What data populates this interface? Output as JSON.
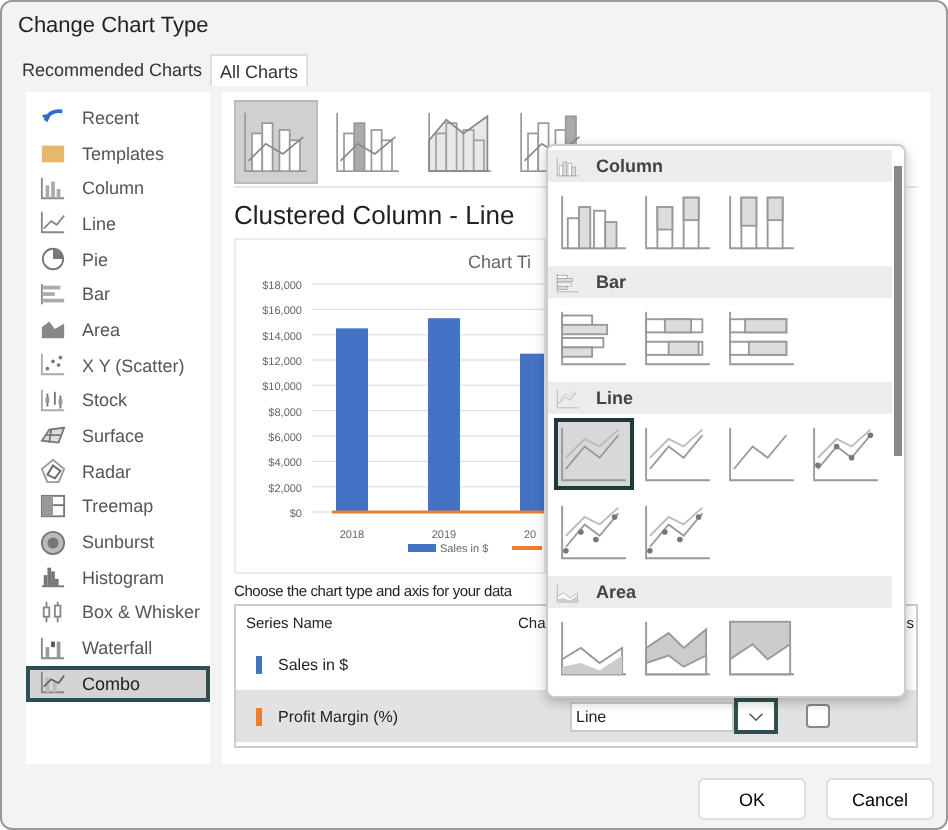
{
  "window": {
    "title": "Change Chart Type"
  },
  "tabs": [
    {
      "label": "Recommended Charts",
      "selected": false
    },
    {
      "label": "All Charts",
      "selected": true
    }
  ],
  "sidebar": {
    "items": [
      {
        "label": "Recent",
        "selected": false
      },
      {
        "label": "Templates",
        "selected": false
      },
      {
        "label": "Column",
        "selected": false
      },
      {
        "label": "Line",
        "selected": false
      },
      {
        "label": "Pie",
        "selected": false
      },
      {
        "label": "Bar",
        "selected": false
      },
      {
        "label": "Area",
        "selected": false
      },
      {
        "label": "X Y (Scatter)",
        "selected": false
      },
      {
        "label": "Stock",
        "selected": false
      },
      {
        "label": "Surface",
        "selected": false
      },
      {
        "label": "Radar",
        "selected": false
      },
      {
        "label": "Treemap",
        "selected": false
      },
      {
        "label": "Sunburst",
        "selected": false
      },
      {
        "label": "Histogram",
        "selected": false
      },
      {
        "label": "Box & Whisker",
        "selected": false
      },
      {
        "label": "Waterfall",
        "selected": false
      },
      {
        "label": "Combo",
        "selected": true
      }
    ]
  },
  "subtypes": [
    {
      "selected": true
    },
    {
      "selected": false
    },
    {
      "selected": false
    },
    {
      "selected": false
    }
  ],
  "chart_name": "Clustered Column - Line",
  "preview": {
    "chart_data": {
      "type": "bar",
      "title": "Chart Ti",
      "categories": [
        "2018",
        "2019",
        "20"
      ],
      "series": [
        {
          "name": "Sales in $",
          "color": "#4472c4",
          "values": [
            14500,
            15300,
            12500
          ]
        },
        {
          "color": "#ed7d31",
          "values": [
            0,
            0,
            0
          ]
        }
      ],
      "grid": true,
      "ylim": [
        0,
        18000
      ],
      "yticks": [
        {
          "value": 0,
          "label": "$0"
        },
        {
          "value": 2000,
          "label": "$2,000"
        },
        {
          "value": 4000,
          "label": "$4,000"
        },
        {
          "value": 6000,
          "label": "$6,000"
        },
        {
          "value": 8000,
          "label": "$8,000"
        },
        {
          "value": 10000,
          "label": "$10,000"
        },
        {
          "value": 12000,
          "label": "$12,000"
        },
        {
          "value": 14000,
          "label": "$14,000"
        },
        {
          "value": 16000,
          "label": "$16,000"
        },
        {
          "value": 18000,
          "label": "$18,000"
        }
      ]
    }
  },
  "instruction": "Choose the chart type and axis for your data",
  "series_table": {
    "columns": [
      "Series Name",
      "Cha",
      "s"
    ],
    "rows": [
      {
        "name": "Sales in $",
        "color": "#4472c4",
        "selected": false
      },
      {
        "name": "Profit Margin (%)",
        "color": "#ed7d31",
        "selected": true,
        "chart_type": "Line",
        "secondary_axis": false
      }
    ]
  },
  "dropdown": {
    "sections": [
      {
        "label": "Column",
        "kind": "column",
        "thumbs": [
          {
            "selected": false
          },
          {
            "selected": false
          },
          {
            "selected": false
          }
        ]
      },
      {
        "label": "Bar",
        "kind": "bar",
        "thumbs": [
          {
            "selected": false
          },
          {
            "selected": false
          },
          {
            "selected": false
          }
        ]
      },
      {
        "label": "Line",
        "kind": "line",
        "thumbs": [
          {
            "selected": true
          },
          {
            "selected": false
          },
          {
            "selected": false
          },
          {
            "selected": false
          },
          {
            "selected": false
          },
          {
            "selected": false
          }
        ]
      },
      {
        "label": "Area",
        "kind": "area",
        "thumbs": [
          {
            "selected": false
          },
          {
            "selected": false
          },
          {
            "selected": false
          }
        ]
      }
    ]
  },
  "buttons": [
    "OK",
    "Cancel"
  ]
}
